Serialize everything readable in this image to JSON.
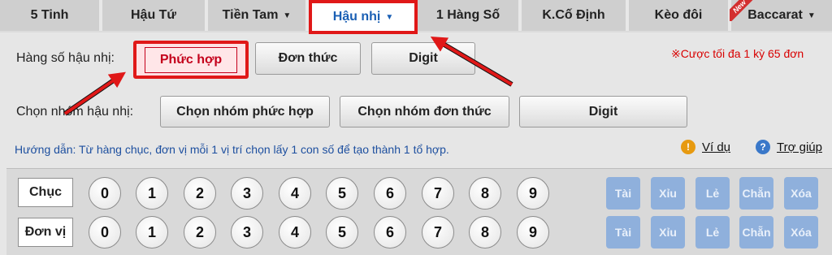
{
  "tabs": [
    {
      "label": "5 Tinh",
      "has_caret": false,
      "active": false
    },
    {
      "label": "Hậu Tứ",
      "has_caret": false,
      "active": false
    },
    {
      "label": "Tiền Tam",
      "has_caret": true,
      "active": false
    },
    {
      "label": "Hậu nhị",
      "has_caret": true,
      "active": true
    },
    {
      "label": "1 Hàng Số",
      "has_caret": false,
      "active": false
    },
    {
      "label": "K.Cố Định",
      "has_caret": false,
      "active": false
    },
    {
      "label": "Kèo đôi",
      "has_caret": false,
      "active": false
    },
    {
      "label": "Baccarat",
      "has_caret": true,
      "active": false,
      "badge": "New"
    }
  ],
  "position_row": {
    "label": "Hàng số hậu nhị:",
    "options": [
      "Phức hợp",
      "Đơn thức",
      "Digit"
    ],
    "selected": "Phức hợp"
  },
  "notice": "※Cược tối đa 1 kỳ 65 đơn",
  "group_row": {
    "label": "Chọn nhóm hậu nhị:",
    "buttons": [
      "Chọn nhóm phức hợp",
      "Chọn nhóm đơn thức",
      "Digit"
    ]
  },
  "guide": "Hướng dẫn:  Từ hàng chục, đơn vị mỗi 1 vị trí chọn lấy 1 con số để tạo thành 1 tổ hợp.",
  "help_links": {
    "example": "Ví dụ",
    "help": "Trợ giúp"
  },
  "digit_rows": [
    {
      "label": "Chục",
      "digits": [
        "0",
        "1",
        "2",
        "3",
        "4",
        "5",
        "6",
        "7",
        "8",
        "9"
      ]
    },
    {
      "label": "Đơn vị",
      "digits": [
        "0",
        "1",
        "2",
        "3",
        "4",
        "5",
        "6",
        "7",
        "8",
        "9"
      ]
    }
  ],
  "quick_buttons": [
    "Tài",
    "Xỉu",
    "Lẻ",
    "Chẵn",
    "Xóa"
  ],
  "colors": {
    "active_tab_text": "#1a5fb4",
    "highlight_red": "#e01818",
    "notice_red": "#d80000",
    "guide_blue": "#1d4f9f",
    "quick_button": "#8fb0dc"
  }
}
